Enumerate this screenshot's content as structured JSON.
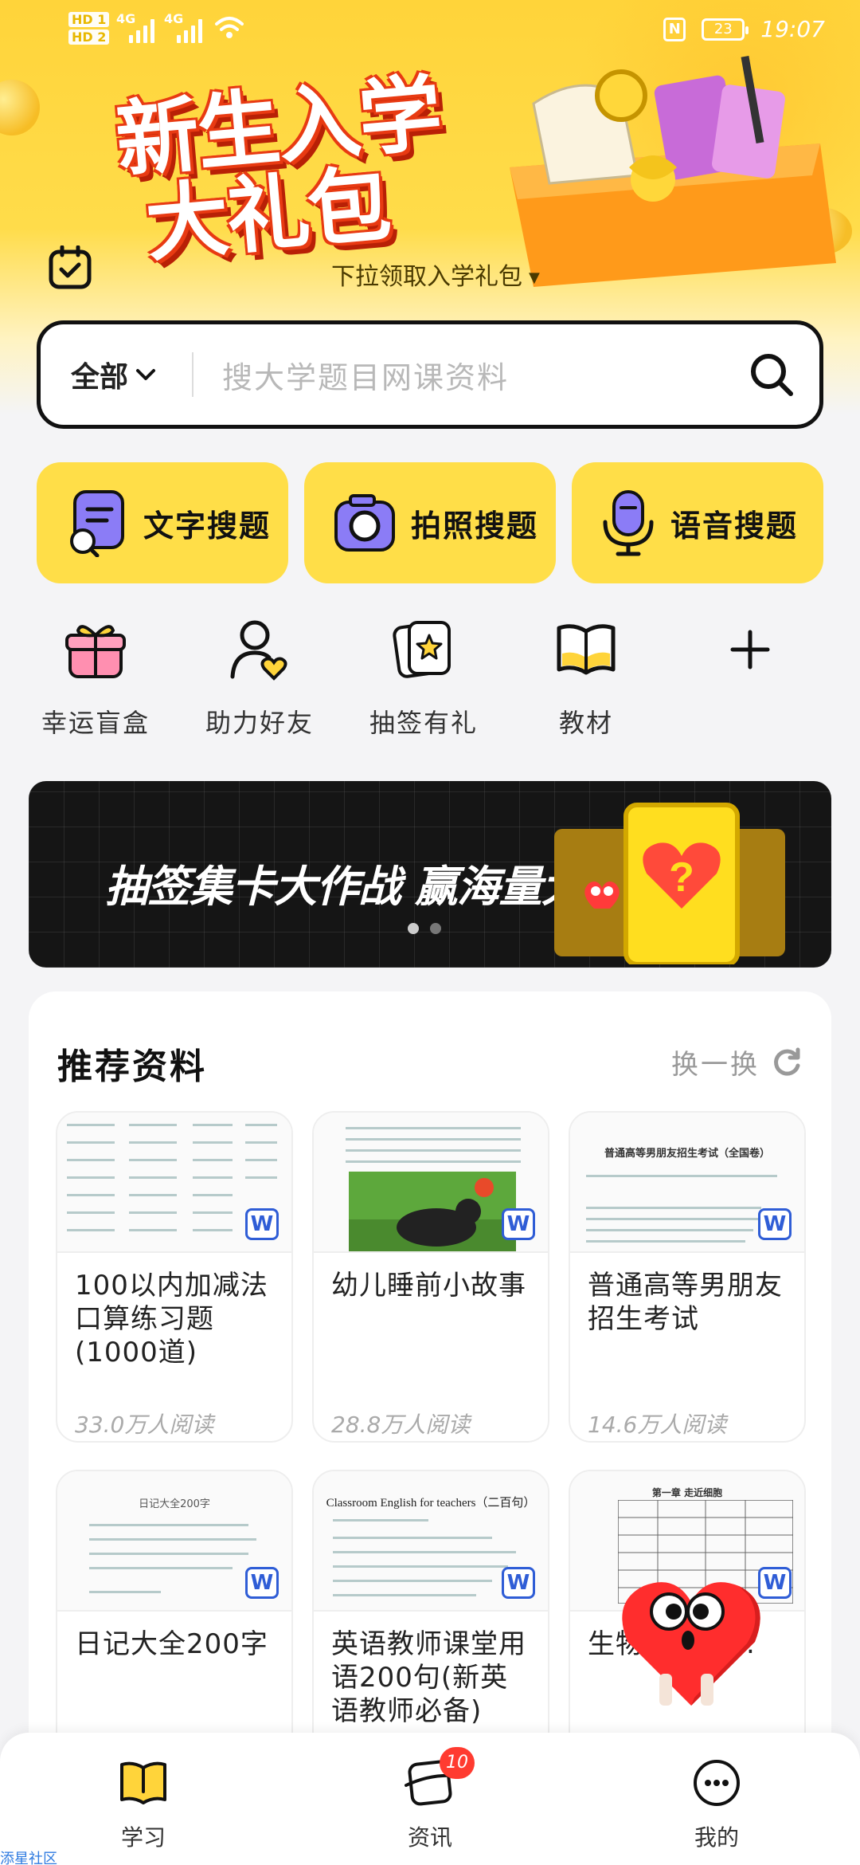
{
  "status_bar": {
    "sim1": "HD 1",
    "sim2": "HD 2",
    "net1": "4G",
    "net2": "4G",
    "battery": "23",
    "time": "19:07"
  },
  "hero": {
    "promo_line1": "新生入学",
    "promo_line2": "大礼包",
    "pull_tip": "下拉领取入学礼包",
    "calendar_icon": "calendar-check-icon"
  },
  "search": {
    "scope": "全部",
    "placeholder": "搜大学题目网课资料"
  },
  "quick_search": [
    {
      "label": "文字搜题",
      "icon": "text-search-icon"
    },
    {
      "label": "拍照搜题",
      "icon": "camera-icon"
    },
    {
      "label": "语音搜题",
      "icon": "microphone-icon"
    }
  ],
  "shortcuts": [
    {
      "label": "幸运盲盒",
      "icon": "gift-box-icon"
    },
    {
      "label": "助力好友",
      "icon": "user-heart-icon"
    },
    {
      "label": "抽签有礼",
      "icon": "star-card-icon"
    },
    {
      "label": "教材",
      "icon": "book-icon"
    },
    {
      "label": "",
      "icon": "plus-icon"
    }
  ],
  "banner": {
    "text": "抽签集卡大作战 赢海量大奖"
  },
  "recommend": {
    "title": "推荐资料",
    "refresh_label": "换一换",
    "items": [
      {
        "title": "100以内加减法口算练习题(1000道)",
        "reads": "33.0万人阅读",
        "thumb_heading": ""
      },
      {
        "title": "幼儿睡前小故事",
        "reads": "28.8万人阅读",
        "thumb_heading": ""
      },
      {
        "title": "普通高等男朋友招生考试",
        "reads": "14.6万人阅读",
        "thumb_heading": "普通高等男朋友招生考试（全国卷）"
      },
      {
        "title": "日记大全200字",
        "reads": "",
        "thumb_heading": "日记大全200字"
      },
      {
        "title": "英语教师课堂用语200句(新英语教师必备)",
        "reads": "",
        "thumb_heading": "Classroom English for teachers（二百句）"
      },
      {
        "title": "生物...维导...",
        "reads": "",
        "thumb_heading": "第一章 走近细胞"
      }
    ],
    "doc_badge": "W"
  },
  "tabbar": {
    "tabs": [
      {
        "label": "学习",
        "icon": "book-open-icon"
      },
      {
        "label": "资讯",
        "icon": "news-icon",
        "badge": "10"
      },
      {
        "label": "我的",
        "icon": "profile-face-icon"
      }
    ]
  },
  "watermark": "添星社区"
}
